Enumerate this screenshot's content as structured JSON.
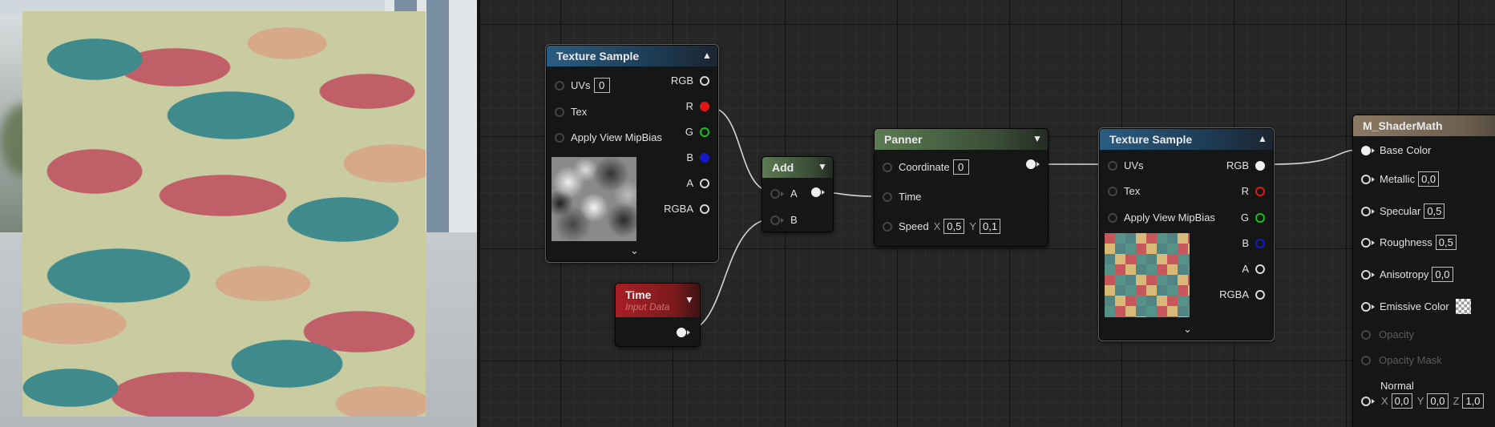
{
  "preview": {
    "label": "Material preview"
  },
  "nodes": {
    "tex1": {
      "title": "Texture Sample",
      "inputs": {
        "uvs": "UVs",
        "uvs_value": "0",
        "tex": "Tex",
        "mip": "Apply View MipBias"
      },
      "outputs": {
        "rgb": "RGB",
        "r": "R",
        "g": "G",
        "b": "B",
        "a": "A",
        "rgba": "RGBA"
      }
    },
    "time": {
      "title": "Time",
      "subtitle": "Input Data"
    },
    "add": {
      "title": "Add",
      "a": "A",
      "b": "B"
    },
    "panner": {
      "title": "Panner",
      "coordinate": "Coordinate",
      "coordinate_value": "0",
      "time": "Time",
      "speed": "Speed",
      "x_label": "X",
      "x_value": "0,5",
      "y_label": "Y",
      "y_value": "0,1"
    },
    "tex2": {
      "title": "Texture Sample",
      "inputs": {
        "uvs": "UVs",
        "tex": "Tex",
        "mip": "Apply View MipBias"
      },
      "outputs": {
        "rgb": "RGB",
        "r": "R",
        "g": "G",
        "b": "B",
        "a": "A",
        "rgba": "RGBA"
      }
    },
    "material": {
      "title": "M_ShaderMath",
      "base_color": "Base Color",
      "metallic": "Metallic",
      "metallic_value": "0,0",
      "specular": "Specular",
      "specular_value": "0,5",
      "roughness": "Roughness",
      "roughness_value": "0,5",
      "anisotropy": "Anisotropy",
      "anisotropy_value": "0,0",
      "emissive": "Emissive Color",
      "opacity": "Opacity",
      "opacity_mask": "Opacity Mask",
      "normal": "Normal",
      "normal_x_label": "X",
      "normal_x": "0,0",
      "normal_y_label": "Y",
      "normal_y": "0,0",
      "normal_z_label": "Z",
      "normal_z": "1,0"
    }
  },
  "colors": {
    "pin_red": "#e01818",
    "pin_green": "#18c018",
    "pin_blue": "#1818c8",
    "header_blue": "#2a5d82",
    "header_green": "#5b7b52",
    "header_red": "#a81f24"
  }
}
